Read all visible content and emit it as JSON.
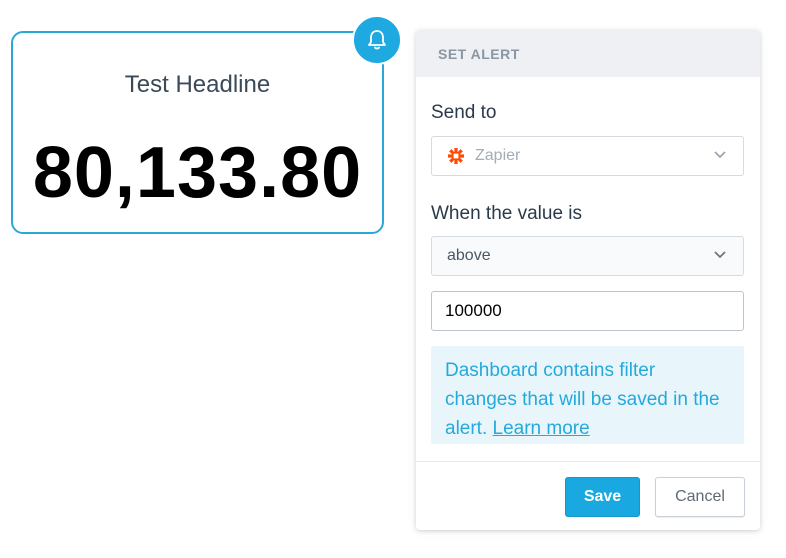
{
  "headline": {
    "title": "Test Headline",
    "value": "80,133.80"
  },
  "alert_panel": {
    "header": "SET ALERT",
    "send_to": {
      "label": "Send to",
      "selected": "Zapier",
      "icon": "zapier-icon"
    },
    "condition": {
      "label": "When the value is",
      "selected": "above"
    },
    "threshold": {
      "value": "100000"
    },
    "info": {
      "text": "Dashboard contains filter changes that will be saved in the alert.",
      "link": "Learn more"
    },
    "buttons": {
      "save": "Save",
      "cancel": "Cancel"
    }
  },
  "colors": {
    "accent": "#1ea9e1",
    "zapier": "#ff4a00",
    "info_bg": "#e8f6fc"
  }
}
